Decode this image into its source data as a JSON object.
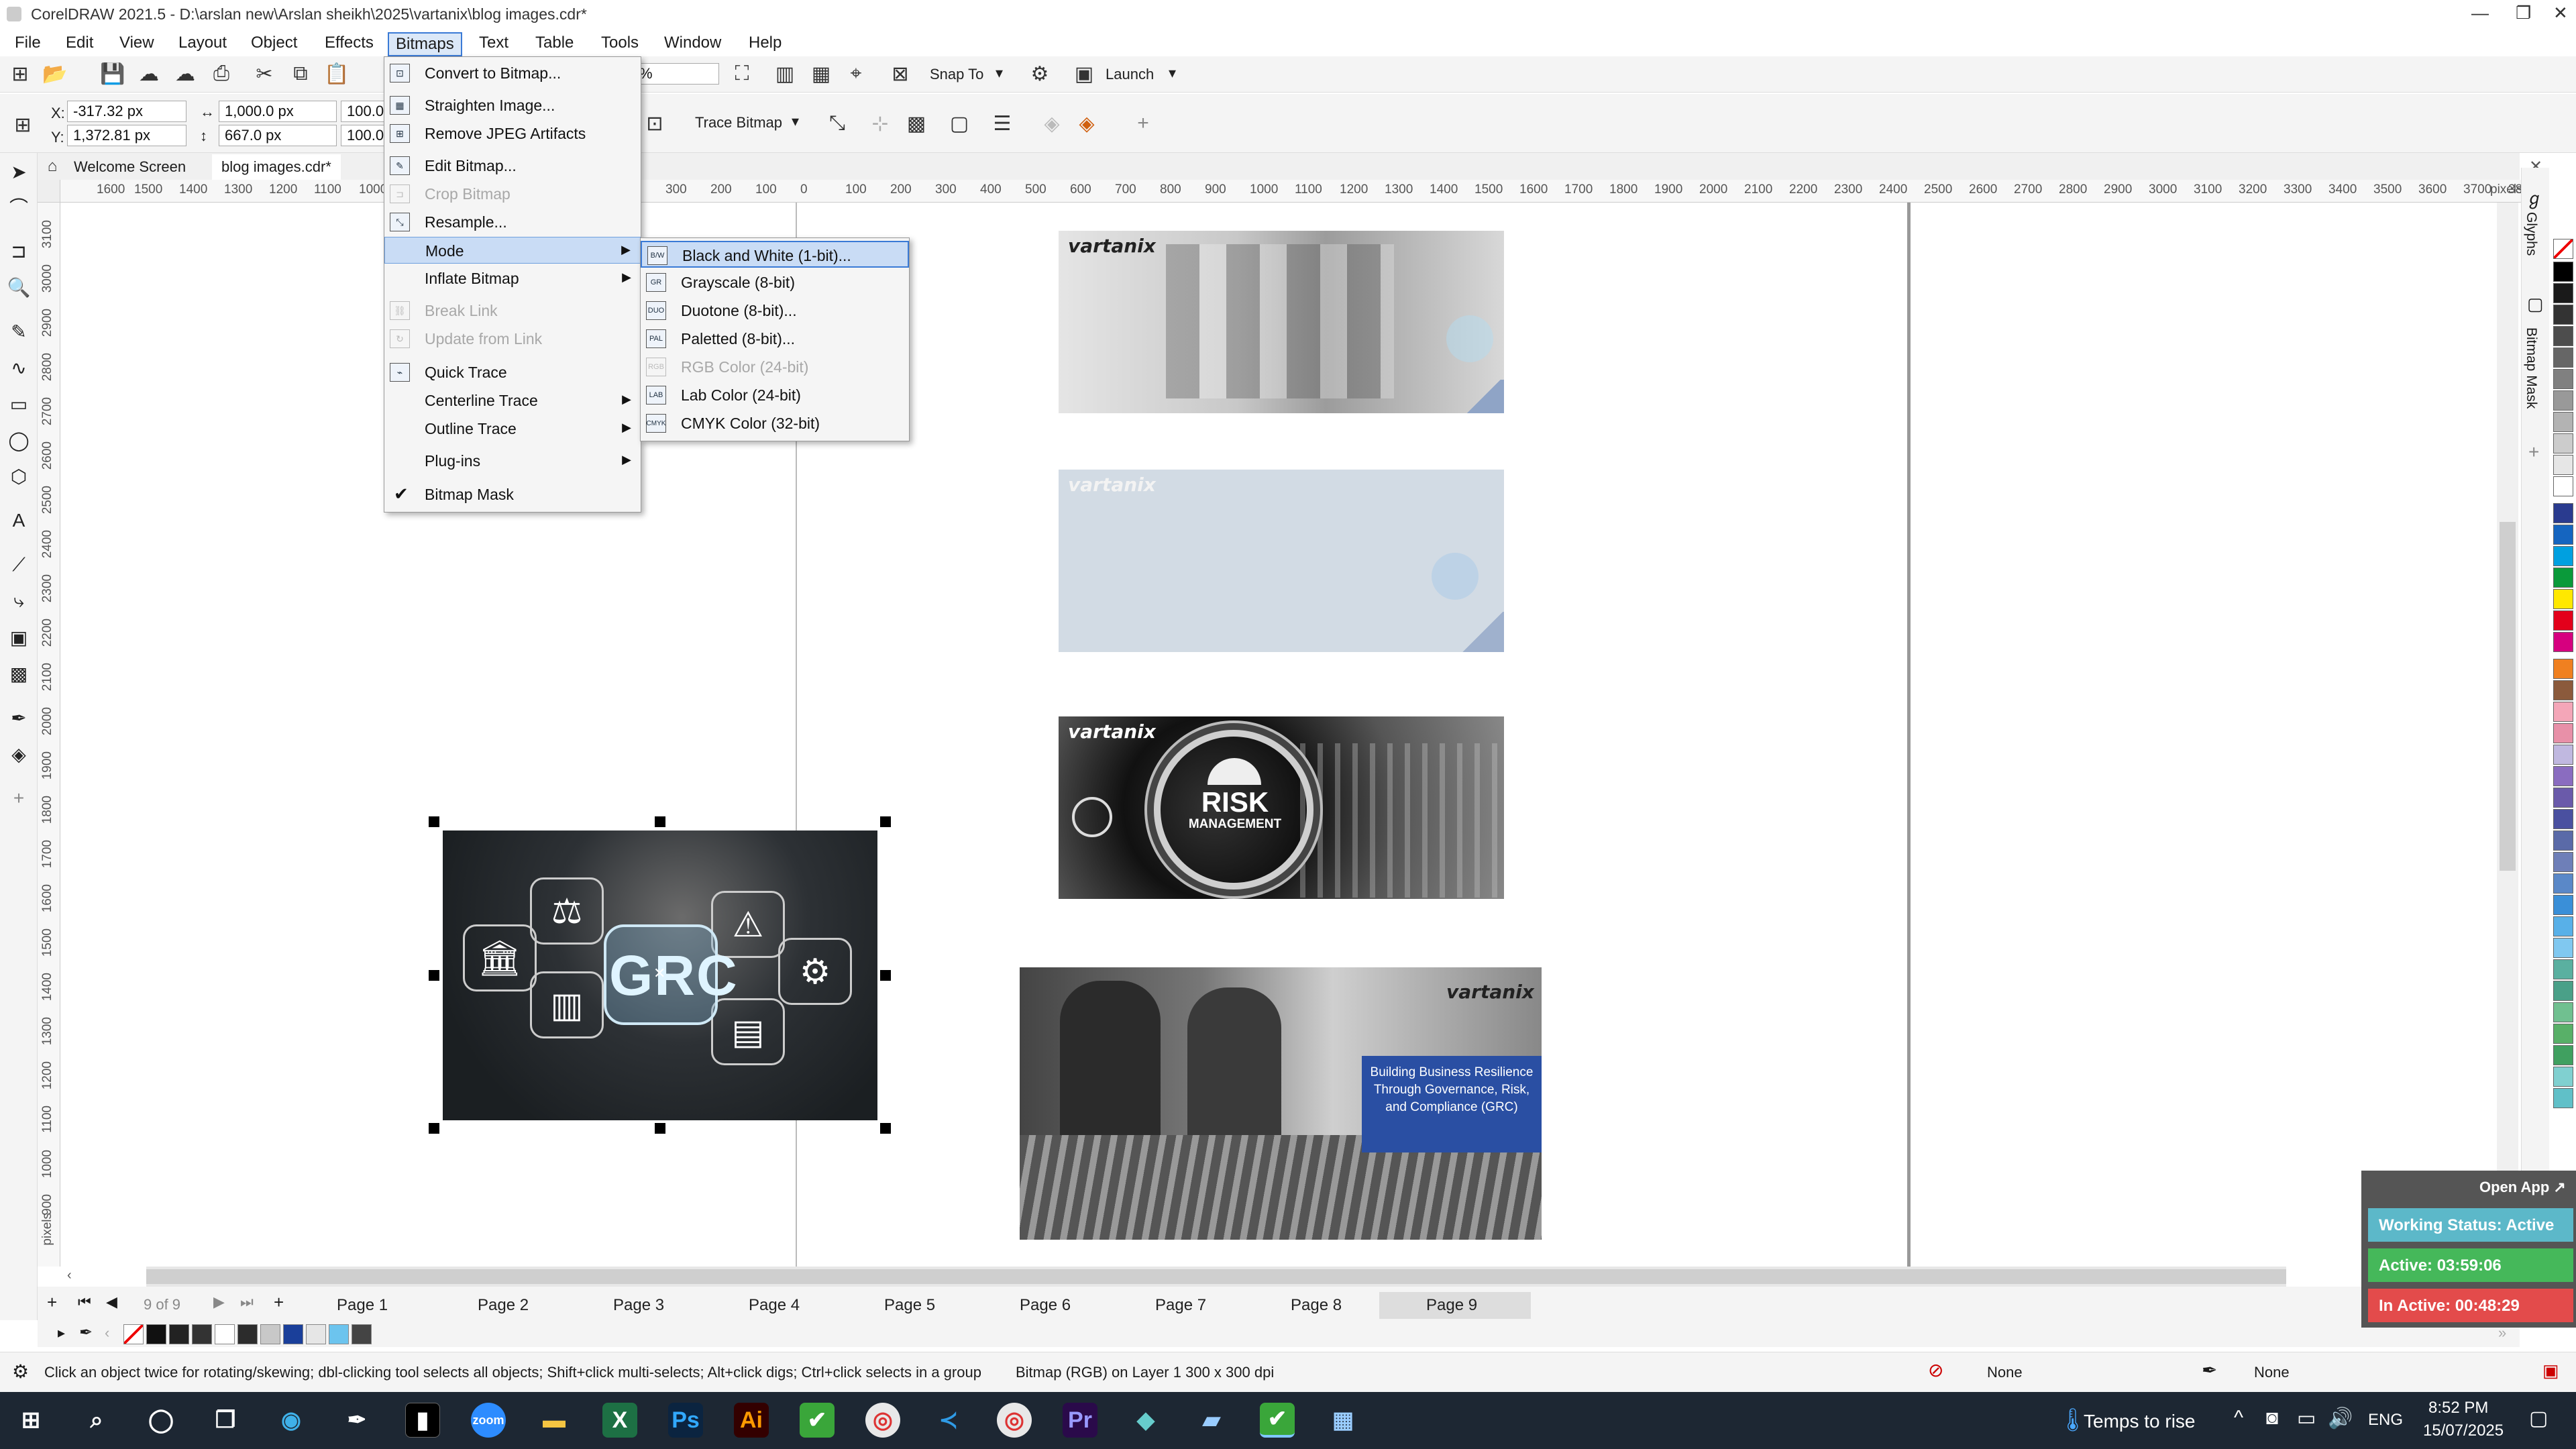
{
  "window": {
    "title": "CorelDRAW 2021.5 - D:\\arslan new\\Arslan sheikh\\2025\\vartanix\\blog images.cdr*",
    "minimize": "—",
    "maximize": "❐",
    "close": "✕"
  },
  "menubar": [
    "File",
    "Edit",
    "View",
    "Layout",
    "Object",
    "Effects",
    "Bitmaps",
    "Text",
    "Table",
    "Tools",
    "Window",
    "Help"
  ],
  "active_menu": "Bitmaps",
  "toolbar": {
    "zoom_fragment": "%",
    "snap_to": "Snap To",
    "launch": "Launch"
  },
  "propbar": {
    "x_label": "X:",
    "x_value": "-317.32 px",
    "y_label": "Y:",
    "y_value": "1,372.81 px",
    "w_value": "1,000.0 px",
    "h_value": "667.0 px",
    "scale_x": "100.0",
    "scale_y": "100.0",
    "trace_bitmap": "Trace Bitmap"
  },
  "doc_tabs": [
    "Welcome Screen",
    "blog images.cdr*"
  ],
  "hruler_labels": [
    "1600",
    "1500",
    "1400",
    "1300",
    "1200",
    "1100",
    "1000",
    "300",
    "200",
    "100",
    "0",
    "100",
    "200",
    "300",
    "400",
    "500",
    "600",
    "700",
    "800",
    "900",
    "1000",
    "1100",
    "1200",
    "1300",
    "1400",
    "1500",
    "1600",
    "1700",
    "1800",
    "1900",
    "2000",
    "2100",
    "2200",
    "2300",
    "2400",
    "2500",
    "2600",
    "2700",
    "2800",
    "2900",
    "3000",
    "3100",
    "3200",
    "3300",
    "3400",
    "3500",
    "3600",
    "3700",
    "3800"
  ],
  "hruler_units": "pixels",
  "vruler_labels": [
    "3100",
    "3000",
    "2900",
    "2800",
    "2700",
    "2600",
    "2500",
    "2400",
    "2300",
    "2200",
    "2100",
    "2000",
    "1900",
    "1800",
    "1700",
    "1600",
    "1500",
    "1400",
    "1300",
    "1200",
    "1100",
    "1000",
    "900"
  ],
  "vruler_units": "pixels",
  "bitmaps_menu": [
    {
      "label": "Convert to Bitmap...",
      "icon": "convert-bitmap-icon",
      "disabled": false
    },
    {
      "label": "Straighten Image...",
      "icon": "straighten-icon",
      "disabled": false
    },
    {
      "label": "Remove JPEG Artifacts",
      "icon": "jpeg-artifacts-icon",
      "disabled": false
    },
    {
      "label": "Edit Bitmap...",
      "icon": "edit-bitmap-icon",
      "disabled": false
    },
    {
      "label": "Crop Bitmap",
      "icon": "crop-bitmap-icon",
      "disabled": true
    },
    {
      "label": "Resample...",
      "icon": "resample-icon",
      "disabled": false
    },
    {
      "label": "Mode",
      "icon": "",
      "disabled": false,
      "submenu": true,
      "highlighted": true
    },
    {
      "label": "Inflate Bitmap",
      "icon": "",
      "disabled": false,
      "submenu": true
    },
    {
      "label": "Break Link",
      "icon": "break-link-icon",
      "disabled": true
    },
    {
      "label": "Update from Link",
      "icon": "update-link-icon",
      "disabled": true
    },
    {
      "label": "Quick Trace",
      "icon": "quick-trace-icon",
      "disabled": false
    },
    {
      "label": "Centerline Trace",
      "icon": "",
      "disabled": false,
      "submenu": true
    },
    {
      "label": "Outline Trace",
      "icon": "",
      "disabled": false,
      "submenu": true
    },
    {
      "label": "Plug-ins",
      "icon": "",
      "disabled": false,
      "submenu": true
    },
    {
      "label": "Bitmap Mask",
      "icon": "check-icon",
      "disabled": false,
      "checked": true
    }
  ],
  "mode_submenu": [
    {
      "label": "Black and White (1-bit)...",
      "badge": "B/W",
      "disabled": false,
      "highlighted": true
    },
    {
      "label": "Grayscale (8-bit)",
      "badge": "GR",
      "disabled": false
    },
    {
      "label": "Duotone (8-bit)...",
      "badge": "DUO",
      "disabled": false
    },
    {
      "label": "Paletted (8-bit)...",
      "badge": "PAL",
      "disabled": false
    },
    {
      "label": "RGB Color (24-bit)",
      "badge": "RGB",
      "disabled": true
    },
    {
      "label": "Lab Color (24-bit)",
      "badge": "LAB",
      "disabled": false
    },
    {
      "label": "CMYK Color (32-bit)",
      "badge": "CMYK",
      "disabled": false
    }
  ],
  "canvas": {
    "brand": "vartanix",
    "risk_title": "RISK",
    "risk_sub": "MANAGEMENT",
    "grc": "GRC",
    "blog_caption": "Building Business Resilience Through Governance, Risk, and Compliance (GRC)"
  },
  "page_nav": {
    "counter": "9 of 9",
    "pages": [
      "Page 1",
      "Page 2",
      "Page 3",
      "Page 4",
      "Page 5",
      "Page 6",
      "Page 7",
      "Page 8",
      "Page 9"
    ],
    "selected": "Page 9"
  },
  "status": {
    "hint": "Click an object twice for rotating/skewing; dbl-clicking tool selects all objects; Shift+click multi-selects; Alt+click digs; Ctrl+click selects in a group",
    "object_info": "Bitmap (RGB) on Layer 1 300 x 300 dpi",
    "fill": "None",
    "outline": "None"
  },
  "docker": {
    "glyphs": "Glyphs",
    "bitmap_mask": "Bitmap Mask"
  },
  "widget": {
    "open_app": "Open App ↗",
    "working_status": "Working Status: Active",
    "active": "Active: 03:59:06",
    "inactive": "In Active: 00:48:29"
  },
  "taskbar": {
    "weather": "Temps to rise",
    "lang": "ENG",
    "time": "8:52 PM",
    "date": "15/07/2025"
  },
  "colors": {
    "accent": "#3a7ad6",
    "menu_highlight": "#c9dcf5",
    "taskbar": "#1d2733",
    "working_status": "#5cb8c9",
    "active": "#45b85a",
    "inactive": "#e34b4b"
  }
}
